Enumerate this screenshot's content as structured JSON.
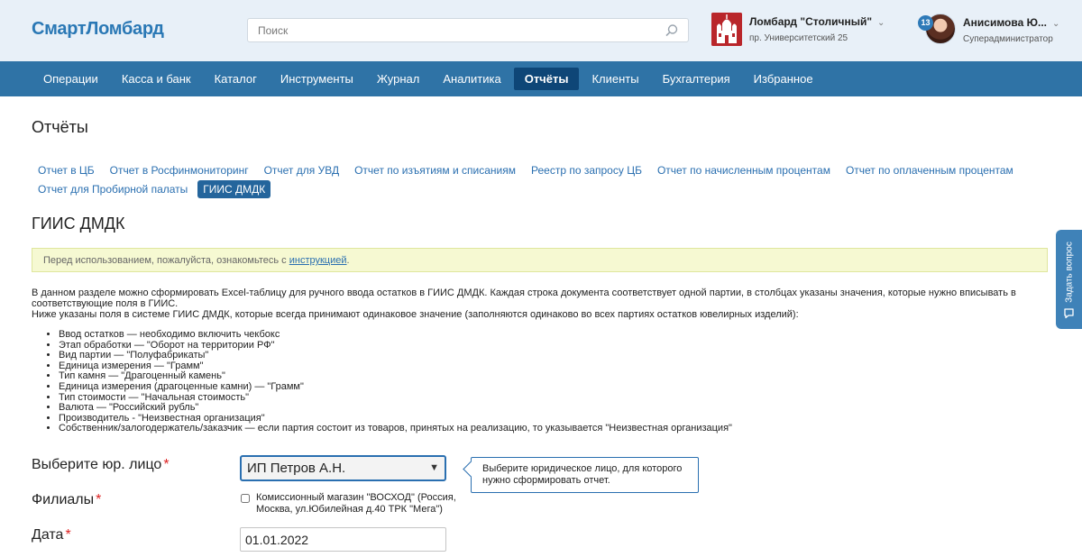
{
  "header": {
    "logo": "СмартЛомбард",
    "search_placeholder": "Поиск",
    "pawnshop_name": "Ломбард \"Столичный\"",
    "pawnshop_address": "пр. Университетский 25",
    "notification_count": "13",
    "user_name": "Анисимова Ю...",
    "user_role": "Суперадминистратор"
  },
  "nav": {
    "items": [
      "Операции",
      "Касса и банк",
      "Каталог",
      "Инструменты",
      "Журнал",
      "Аналитика",
      "Отчёты",
      "Клиенты",
      "Бухгалтерия",
      "Избранное"
    ],
    "active": "Отчёты"
  },
  "page": {
    "title": "Отчёты",
    "tabs": [
      "Отчет в ЦБ",
      "Отчет в Росфинмониторинг",
      "Отчет для УВД",
      "Отчет по изъятиям и списаниям",
      "Реестр по запросу ЦБ",
      "Отчет по начисленным процентам",
      "Отчет по оплаченным процентам",
      "Отчет для Пробирной палаты",
      "ГИИС ДМДК"
    ],
    "active_tab": "ГИИС ДМДК",
    "section_title": "ГИИС ДМДК",
    "notice_prefix": "Перед использованием, пожалуйста, ознакомьтесь с ",
    "notice_link": "инструкцией",
    "notice_suffix": ".",
    "description_1": "В данном разделе можно сформировать Excel-таблицу для ручного ввода остатков в ГИИС ДМДК. Каждая строка документа соответствует одной партии, в столбцах указаны значения, которые нужно вписывать в соответствующие поля в ГИИС.",
    "description_2": "Ниже указаны поля в системе ГИИС ДМДК, которые всегда принимают одинаковое значение (заполняются одинаково во всех партиях остатков ювелирных изделий):",
    "fields": [
      "Ввод остатков — необходимо включить чекбокс",
      "Этап обработки — \"Оборот на территории РФ\"",
      "Вид партии — \"Полуфабрикаты\"",
      "Единица измерения — \"Грамм\"",
      "Тип камня — \"Драгоценный камень\"",
      "Единица измерения (драгоценные камни) — \"Грамм\"",
      "Тип стоимости — \"Начальная стоимость\"",
      "Валюта — \"Российский рубль\"",
      "Производитель - \"Неизвестная организация\"",
      "Собственник/залогодержатель/заказчик — если партия состоит из товаров, принятых на реализацию, то указывается \"Неизвестная организация\""
    ]
  },
  "form": {
    "entity_label": "Выберите юр. лицо",
    "entity_value": "ИП Петров А.Н.",
    "entity_hint": "Выберите юридическое лицо, для которого нужно сформировать отчет.",
    "branches_label": "Филиалы",
    "branch_option": "Комиссионный магазин \"ВОСХОД\" (Россия, Москва, ул.Юбилейная д.40 ТРК \"Мега\")",
    "date_label": "Дата",
    "date_value": "01.01.2022",
    "required_mark": "*"
  },
  "side_tab": {
    "label": "Задать вопрос"
  },
  "colors": {
    "nav_bg": "#2f73a6",
    "nav_active": "#0e4677",
    "link": "#2a6fb0",
    "header_bg": "#e8f0f8",
    "notice_bg": "#f6f9d2"
  }
}
